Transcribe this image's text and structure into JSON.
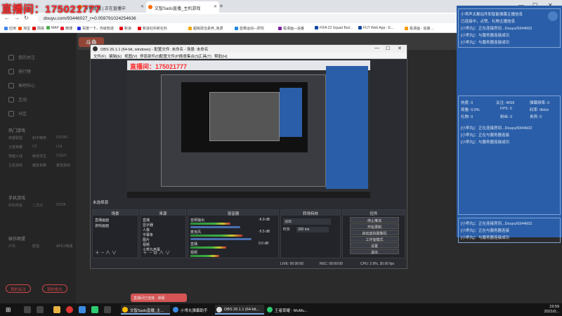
{
  "overlay": {
    "title": "直播间：175021777"
  },
  "browser": {
    "tabs": [
      {
        "label": "斗鱼直播 | 正在直播中"
      },
      {
        "label": "文智Sado直播_主机游戏"
      },
      {
        "label": ""
      }
    ],
    "new_tab": "+",
    "url": "douyu.com/93446027_r=0.05979102425463​6",
    "bookmarks": [
      "应用",
      "淘宝",
      "网易",
      "MAP",
      "微博",
      "百度一下，你就知道",
      "新浪",
      "新浪社科新社科",
      "超级政治素养_免费",
      "蓝莓运动—研究",
      "看漫画—追番",
      "FIFA 22 Squad Buil...",
      "FUT Web App - E...",
      "看漫画 - 追番 ..."
    ]
  },
  "douyu": {
    "logo": "斗鱼",
    "sidebar": [
      "我的关注",
      "排行榜",
      "鱼吧中心",
      "互动",
      "分区"
    ],
    "section_heads": [
      "热门游戏",
      "手机游戏",
      "娱乐联盟"
    ],
    "grid_items": [
      "英雄联盟",
      "和平精英",
      "DOTA2",
      "王者荣耀",
      "CF",
      "LOL",
      "穿越火线",
      "绝地求生",
      "CSGO",
      "主机游戏",
      "魔兽争霸",
      "暴雪游戏",
      "炉石传说",
      "二次元",
      "DOTA",
      "户外",
      "颜值",
      "APEX英雄"
    ],
    "side_buttons": [
      "我的关注",
      "我的鱼丸"
    ]
  },
  "info_panel": {
    "lines": [
      "小乖声太都站件和智能弹幕主播信息",
      "已连接中，点赞、礼物主播信息",
      "[小乖丸]：正在连接房间...Douyu/9344602",
      "[小乖丸]：与服务器连接成功",
      "[小乖丸]：与服务器连接成功"
    ],
    "stats": [
      {
        "k": "热度",
        "v": "0"
      },
      {
        "k": "关注",
        "v": "4659"
      },
      {
        "k": "弹幕频率",
        "v": "0"
      },
      {
        "k": "观看",
        "v": "0.0%"
      },
      {
        "k": "FPS",
        "v": "0"
      },
      {
        "k": "码率",
        "v": "0kb/s"
      },
      {
        "k": "礼物",
        "v": "0"
      },
      {
        "k": "粉丝",
        "v": "0"
      },
      {
        "k": "贵宾",
        "v": "0"
      }
    ],
    "log1": [
      "[小乖丸]：正在连接房间...Douyu/9344602",
      "[小乖丸]：正在与服务器连接",
      "[小乖丸]：与服务器连接成功"
    ],
    "log2": [
      "[小乖丸]：正在连接房间...Douyu/9344602",
      "[小乖丸]：正在与服务器连接",
      "[小乖丸]：与服务器连接成功"
    ]
  },
  "obs": {
    "title": "OBS 26.1.1 (64-bit, windows) - 配置文件: 未命名 - 场景: 未命名",
    "menu": [
      "文件(F)",
      "编辑(E)",
      "视图(V)",
      "停靠部件(D)",
      "配置文件(P)",
      "场景集合(S)",
      "工具(T)",
      "帮助(H)"
    ],
    "scene_label": "未选择源",
    "docks": {
      "scenes": {
        "title": "场景",
        "items": [
          "直播画面",
          "游戏画面"
        ]
      },
      "sources": {
        "title": "来源",
        "items": [
          "直播",
          "显示器",
          "人像",
          "字幕条",
          "图片",
          "视频",
          "小乖丸声幕",
          "小乖丸礼物"
        ]
      },
      "mixer": {
        "title": "混音器",
        "channels": [
          {
            "name": "音频输出",
            "db": "-6.9 dB",
            "level": 0.62
          },
          {
            "name": "麦克风",
            "db": "-5.5 dB",
            "level": 0.8
          },
          {
            "name": "直播",
            "db": "0.0 dB",
            "level": 0.55
          },
          {
            "name": "视频",
            "db": "0.0 dB",
            "level": 0.45
          }
        ]
      },
      "transitions": {
        "title": "转场特效",
        "mode": "淡出",
        "duration_label": "时长",
        "duration": "300 ms"
      },
      "controls": {
        "title": "控件",
        "buttons": [
          "停止推流",
          "开始录制",
          "启动虚拟摄像机",
          "工作室模式",
          "设置",
          "退出"
        ]
      }
    },
    "status": {
      "live": "LIVE: 00:00:00",
      "rec": "REC: 00:00:00",
      "cpu": "CPU: 2.9%, 30.00 fps"
    }
  },
  "taskbar": {
    "apps": [
      "文智Sado直播_主...",
      "小乖丸弹幕助手",
      "OBS 26.1.1 (64-bit...",
      "王者荣耀 - MuMu..."
    ],
    "clock_time": "19:59",
    "clock_date": "2021/0..."
  },
  "chat_hint": "直播间已连接 · 弹幕"
}
